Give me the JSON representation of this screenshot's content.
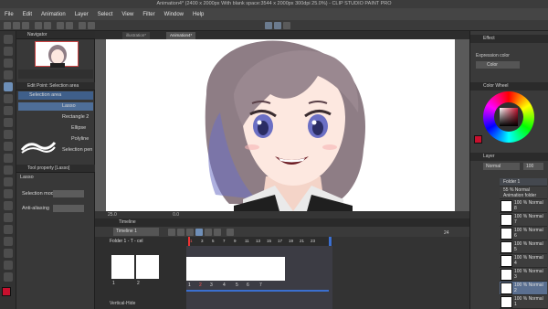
{
  "window": {
    "title": "Animation4* (2400 x 2000px With blank space:3544 x 2000px 300dpi 25.0%) - CLIP STUDIO PAINT PRO"
  },
  "menu": [
    "File",
    "Edit",
    "Animation",
    "Layer",
    "Select",
    "View",
    "Filter",
    "Window",
    "Help"
  ],
  "canvas_tabs": [
    "illustration*",
    "Animation4*"
  ],
  "navigator": {
    "title": "Navigator"
  },
  "tool_panel": {
    "title": "Edit Point: Selection area",
    "active_group": "Selection area",
    "items": [
      "Lasso",
      "Rectangle 2",
      "Ellipse",
      "Polyline",
      "Selection pen"
    ]
  },
  "tool_property": {
    "title": "Tool property [Lasso]",
    "tool_name": "Lasso",
    "selection_mode_label": "Selection mode",
    "anti_aliasing_label": "Anti-aliasing"
  },
  "status": {
    "zoom": "25.0",
    "angle": "0.0"
  },
  "timeline": {
    "title": "Timeline",
    "track_name": "Timeline 1",
    "frame_numbers": [
      "1",
      "3",
      "5",
      "7",
      "9",
      "11",
      "13",
      "15",
      "17",
      "19",
      "21",
      "23"
    ],
    "end_frame": "24",
    "cel_numbers": [
      "1",
      "2",
      "3",
      "4",
      "5",
      "6",
      "7"
    ],
    "left_label": "Folder 1 - T - cel",
    "left_frame_numbers": [
      "1",
      "2"
    ],
    "bottom_label": "Vertical-Hide"
  },
  "right_panel": {
    "effect_title": "Effect",
    "expression_color_label": "Expression color",
    "color_mode": "Color",
    "color_wheel_title": "Color Wheel",
    "layer_title": "Layer",
    "blend_mode": "Normal",
    "opacity": "100",
    "layers": [
      {
        "name": "Folder 1",
        "mode": ""
      },
      {
        "name": "Animation folder",
        "mode": "55 % Normal"
      },
      {
        "name": "8",
        "mode": "100 % Normal"
      },
      {
        "name": "7",
        "mode": "100 % Normal"
      },
      {
        "name": "6",
        "mode": "100 % Normal"
      },
      {
        "name": "5",
        "mode": "100 % Normal"
      },
      {
        "name": "4",
        "mode": "100 % Normal"
      },
      {
        "name": "3",
        "mode": "100 % Normal"
      },
      {
        "name": "2",
        "mode": "100 % Normal"
      },
      {
        "name": "1",
        "mode": "100 % Normal"
      }
    ]
  },
  "colors": {
    "main": "#c8102e",
    "sub": "#ffffff",
    "accent": "#d8d8d8",
    "hair": "#8e7d85",
    "skin": "#fde8e0",
    "eye": "#6b6fc4"
  }
}
